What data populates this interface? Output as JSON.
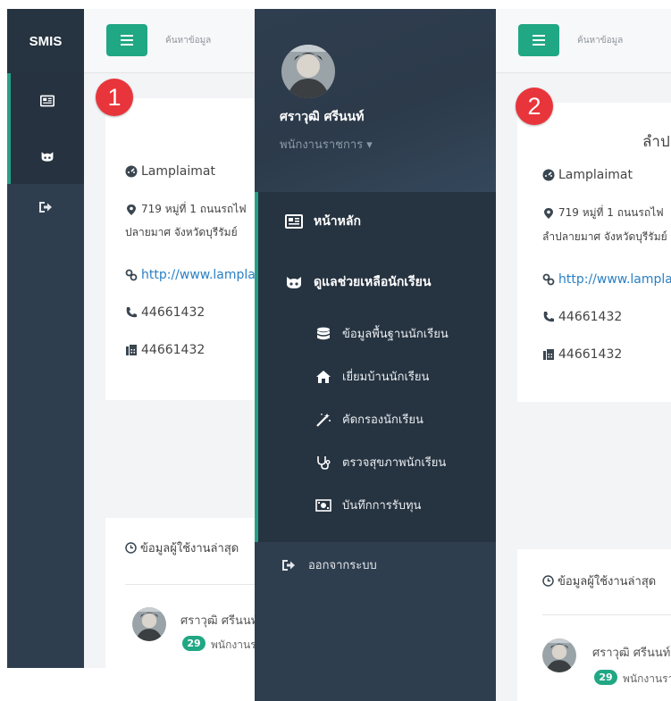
{
  "brand": "SMIS",
  "search_placeholder": "ค้นหาข้อมูล",
  "panel_badges": [
    "1",
    "2"
  ],
  "school": {
    "name": "Lamplaimat",
    "address_line1": "719 หมู่ที่ 1 ถนนรถไฟ",
    "address_line2_p1": "ปลายมาศ จังหวัดบุรีรัมย์",
    "address_line2_p2": "ลำปลายมาศ จังหวัดบุรีรัมย์",
    "website": "http://www.lamplaimat.ac.th",
    "phone": "44661432",
    "fax": "44661432"
  },
  "heading_fragment": "ลำป",
  "recent_users": {
    "title": "ข้อมูลผู้ใช้งานล่าสุด",
    "user_name": "ศราวุฒิ ศรีนนท์",
    "count": "29",
    "role": "พนักงานราชการ"
  },
  "profile": {
    "name": "ศราวุฒิ ศรีนนท์",
    "role": "พนักงานราชการ ▾"
  },
  "menu": {
    "home": "หน้าหลัก",
    "student_care": "ดูแลช่วยเหลือนักเรียน",
    "sub_items": [
      {
        "label": "ข้อมูลพื้นฐานนักเรียน",
        "icon": "database-icon"
      },
      {
        "label": "เยี่ยมบ้านนักเรียน",
        "icon": "home-icon"
      },
      {
        "label": "คัดกรองนักเรียน",
        "icon": "magic-wand-icon"
      },
      {
        "label": "ตรวจสุขภาพนักเรียน",
        "icon": "stethoscope-icon"
      },
      {
        "label": "บันทึกการรับทุน",
        "icon": "money-icon"
      }
    ],
    "logout": "ออกจากระบบ"
  },
  "colors": {
    "sidebar": "#2f3e4f",
    "sidebar_dark": "#263340",
    "accent": "#20a784",
    "badge_red": "#e8353b",
    "link": "#2a80c4"
  }
}
